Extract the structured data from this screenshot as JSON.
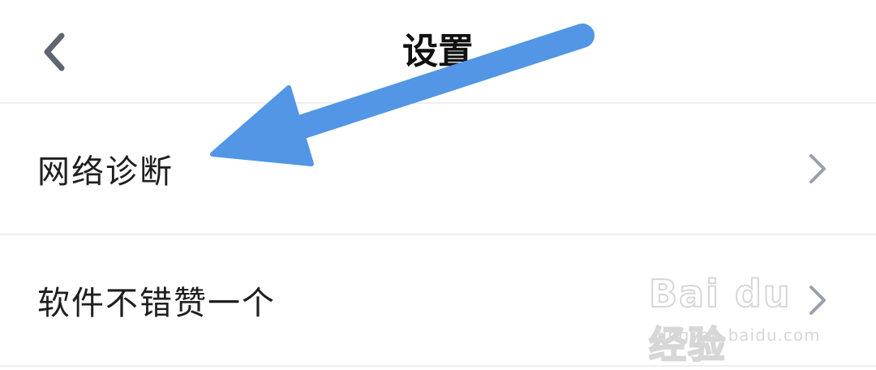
{
  "navbar": {
    "title": "设置",
    "back_icon": "chevron-left-icon"
  },
  "settings_list": {
    "items": [
      {
        "label": "网络诊断",
        "icon": "chevron-right-icon"
      },
      {
        "label": "软件不错赞一个",
        "icon": "chevron-right-icon"
      }
    ]
  },
  "watermark": {
    "logo_text": "Bai du 经验",
    "url": "jingyan.baidu.com"
  },
  "colors": {
    "annotation_arrow": "#5296e5",
    "chevron": "#9aa0ab",
    "divider": "#efefef"
  }
}
